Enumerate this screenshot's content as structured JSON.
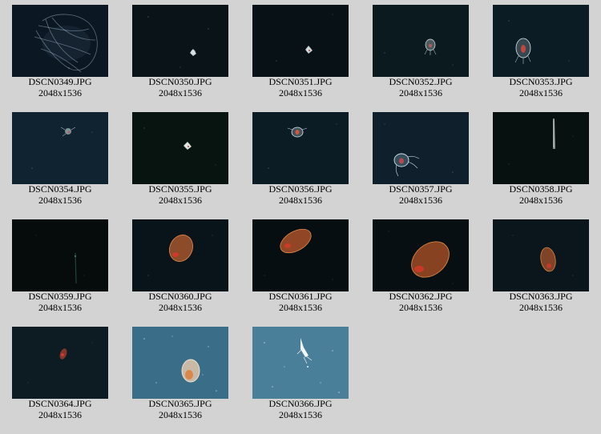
{
  "gallery": {
    "items": [
      {
        "filename": "DSCN0349.JPG",
        "dimensions": "2048x1536",
        "background": "#0b1722",
        "subject": "jellyfish-tentacles"
      },
      {
        "filename": "DSCN0350.JPG",
        "dimensions": "2048x1536",
        "background": "#0a1418",
        "subject": "tiny-white-creature"
      },
      {
        "filename": "DSCN0351.JPG",
        "dimensions": "2048x1536",
        "background": "#081216",
        "subject": "tiny-white-creature"
      },
      {
        "filename": "DSCN0352.JPG",
        "dimensions": "2048x1536",
        "background": "#0b1a1f",
        "subject": "small-translucent-jelly"
      },
      {
        "filename": "DSCN0353.JPG",
        "dimensions": "2048x1536",
        "background": "#0c1c24",
        "subject": "small-jelly-red-gut"
      },
      {
        "filename": "DSCN0354.JPG",
        "dimensions": "2048x1536",
        "background": "#0f2430",
        "subject": "tiny-white-creature"
      },
      {
        "filename": "DSCN0355.JPG",
        "dimensions": "2048x1536",
        "background": "#081410",
        "subject": "tiny-white-creature"
      },
      {
        "filename": "DSCN0356.JPG",
        "dimensions": "2048x1536",
        "background": "#0c1c24",
        "subject": "small-jelly-red-gut"
      },
      {
        "filename": "DSCN0357.JPG",
        "dimensions": "2048x1536",
        "background": "#0f202c",
        "subject": "jelly-with-tentacles"
      },
      {
        "filename": "DSCN0358.JPG",
        "dimensions": "2048x1536",
        "background": "#07110f",
        "subject": "thin-vertical-creature"
      },
      {
        "filename": "DSCN0359.JPG",
        "dimensions": "2048x1536",
        "background": "#060c0c",
        "subject": "faint-green-streak"
      },
      {
        "filename": "DSCN0360.JPG",
        "dimensions": "2048x1536",
        "background": "#09131a",
        "subject": "orange-ctenophore"
      },
      {
        "filename": "DSCN0361.JPG",
        "dimensions": "2048x1536",
        "background": "#060e12",
        "subject": "orange-ctenophore"
      },
      {
        "filename": "DSCN0362.JPG",
        "dimensions": "2048x1536",
        "background": "#070f13",
        "subject": "orange-ctenophore-large"
      },
      {
        "filename": "DSCN0363.JPG",
        "dimensions": "2048x1536",
        "background": "#0a161b",
        "subject": "orange-ctenophore-small"
      },
      {
        "filename": "DSCN0364.JPG",
        "dimensions": "2048x1536",
        "background": "#0d1b22",
        "subject": "tiny-red-creature"
      },
      {
        "filename": "DSCN0365.JPG",
        "dimensions": "2048x1536",
        "background": "#3a6e88",
        "subject": "pale-ctenophore-blue-water"
      },
      {
        "filename": "DSCN0366.JPG",
        "dimensions": "2048x1536",
        "background": "#4a7f9a",
        "subject": "white-jelly-blue-water"
      }
    ]
  }
}
